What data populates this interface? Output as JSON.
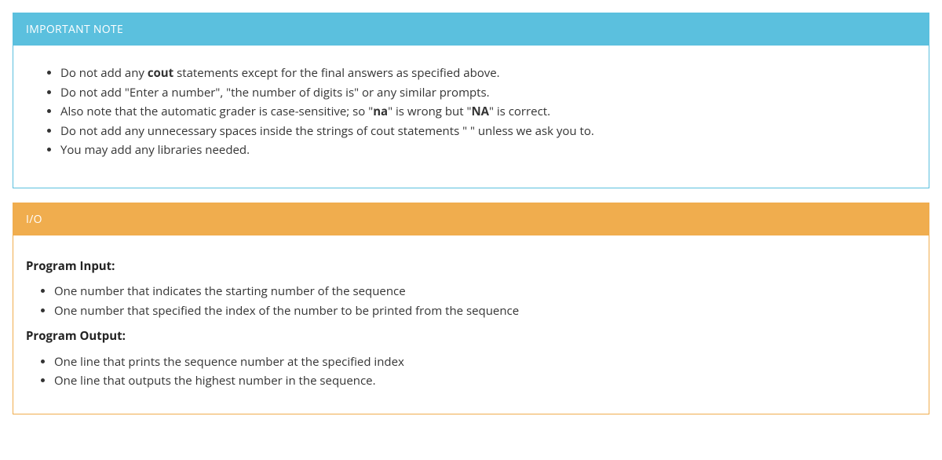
{
  "note_panel": {
    "title": "IMPORTANT NOTE",
    "items": [
      {
        "pre": "Do not add any ",
        "bold": "cout",
        "post": " statements except for the final answers as specified above."
      },
      {
        "pre": "Do not add \"Enter a number\", \"the number of digits is\" or any similar prompts.",
        "bold": "",
        "post": ""
      },
      {
        "pre": "Also note that the automatic grader is case-sensitive; so \"",
        "bold": "na",
        "mid": "\" is wrong but \"",
        "bold2": "NA",
        "post": "\" is correct."
      },
      {
        "pre": "Do not add any unnecessary spaces inside the strings of cout statements \" \" unless we ask you to.",
        "bold": "",
        "post": ""
      },
      {
        "pre": "You may add any libraries needed.",
        "bold": "",
        "post": ""
      }
    ]
  },
  "io_panel": {
    "title": "I/O",
    "input_heading": "Program Input:",
    "input_items": [
      "One number that indicates the starting number of the sequence",
      "One number that specified the index of the number to be printed from the sequence"
    ],
    "output_heading": "Program Output:",
    "output_items": [
      "One line that prints the sequence number at the specified index",
      "One line that outputs the highest number in the sequence."
    ]
  }
}
